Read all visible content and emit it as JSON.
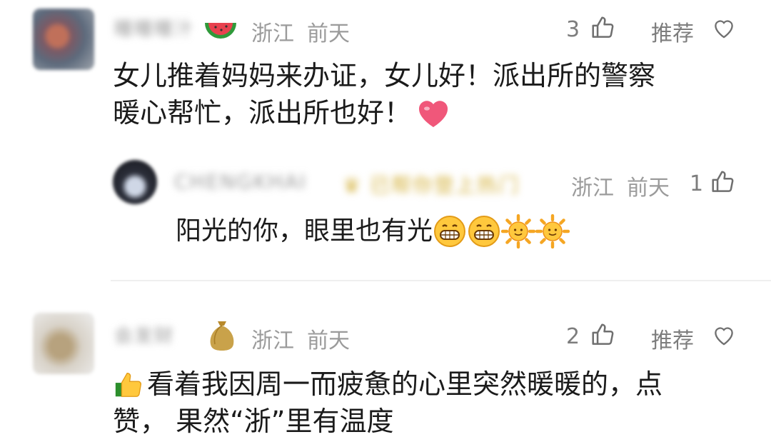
{
  "comments": [
    {
      "location": "浙江",
      "time": "前天",
      "like_count": "3",
      "recommend_label": "推荐",
      "text_line1": "女儿推着妈妈来办证，女儿好！派出所的警察",
      "text_line2": "暖心帮忙，派出所也好！",
      "reply": {
        "location": "浙江",
        "time": "前天",
        "like_count": "1",
        "text": "阳光的你，眼里也有光"
      }
    },
    {
      "location": "浙江",
      "time": "前天",
      "like_count": "2",
      "recommend_label": "推荐",
      "text_line1": "看着我因周一而疲惫的心里突然暖暖的，点",
      "text_line2": "赞， 果然“浙”里有温度"
    }
  ],
  "icons": {
    "thumb": "thumbs-up-outline-icon",
    "heart": "heart-outline-icon"
  },
  "colors": {
    "meta_gray": "#9b9b9b",
    "heart_emoji": "#f0577a",
    "sun_emoji": "#f5a623"
  }
}
